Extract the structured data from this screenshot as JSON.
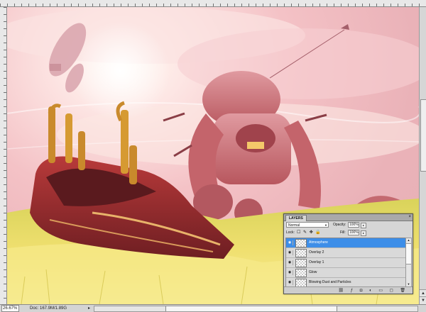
{
  "statusbar": {
    "zoom": "26.67%",
    "doc": "Doc: 167.9M/1.89G",
    "arrow": "▸"
  },
  "layers_panel": {
    "tab": "LAYERS",
    "close": "×",
    "blend_mode": "Normal",
    "opacity_label": "Opacity:",
    "opacity_value": "100%",
    "lock_label": "Lock:",
    "lock_icons": "☐ ✎ ✥ 🔒",
    "fill_label": "Fill:",
    "fill_value": "100%",
    "layers": [
      {
        "name": "Atmosphere",
        "selected": true
      },
      {
        "name": "Overlay 2",
        "selected": false
      },
      {
        "name": "Overlay 1",
        "selected": false
      },
      {
        "name": "Glow",
        "selected": false
      },
      {
        "name": "Blowing Dust and Particles",
        "selected": false
      }
    ],
    "footer_icons": [
      "link-icon",
      "fx-icon",
      "mask-icon",
      "adjustment-icon",
      "folder-icon",
      "new-layer-icon",
      "trash-icon"
    ]
  },
  "colors": {
    "selected_layer": "#3d8ee8",
    "sky": "#f4c2c6",
    "grass": "#e8d44a",
    "robot": "#c86a6f"
  }
}
